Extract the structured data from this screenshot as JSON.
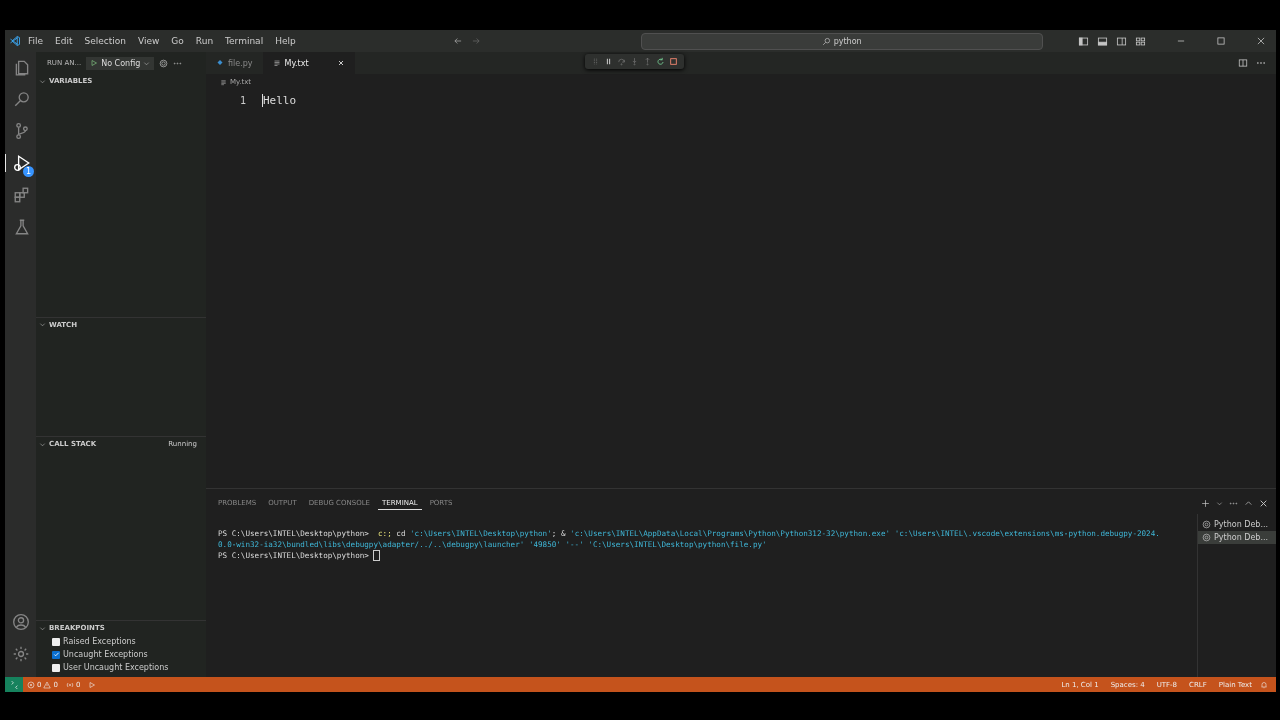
{
  "menu": [
    "File",
    "Edit",
    "Selection",
    "View",
    "Go",
    "Run",
    "Terminal",
    "Help"
  ],
  "command_center": {
    "value": "python"
  },
  "activity_bar": [
    {
      "kind": "files",
      "selected": false
    },
    {
      "kind": "search",
      "selected": false
    },
    {
      "kind": "branch",
      "selected": false
    },
    {
      "kind": "debug",
      "selected": true,
      "badge": "1"
    },
    {
      "kind": "extensions",
      "selected": false
    },
    {
      "kind": "flask",
      "selected": false
    }
  ],
  "sidebar": {
    "title": "RUN AN...",
    "config": "No Config",
    "sections": [
      {
        "title": "VARIABLES"
      },
      {
        "title": "WATCH"
      },
      {
        "title": "CALL STACK",
        "status": "Running"
      }
    ],
    "breakpoints": {
      "title": "BREAKPOINTS",
      "items": [
        {
          "label": "Raised Exceptions",
          "checked": false
        },
        {
          "label": "Uncaught Exceptions",
          "checked": true
        },
        {
          "label": "User Uncaught Exceptions",
          "checked": false
        }
      ]
    }
  },
  "tabs": [
    {
      "label": "file.py",
      "kind": "python",
      "selected": false
    },
    {
      "label": "My.txt",
      "kind": "text",
      "selected": true
    }
  ],
  "breadcrumb": "My.txt",
  "editor": {
    "lines": [
      {
        "number": "1",
        "text": "Hello"
      }
    ]
  },
  "panel": {
    "tabs": [
      {
        "label": "PROBLEMS",
        "selected": false
      },
      {
        "label": "OUTPUT",
        "selected": false
      },
      {
        "label": "DEBUG CONSOLE",
        "selected": false
      },
      {
        "label": "TERMINAL",
        "selected": true
      },
      {
        "label": "PORTS",
        "selected": false
      }
    ],
    "terminal": [
      [
        {
          "kind": "prompt",
          "text": "PS C:\\Users\\INTEL\\Desktop\\python>  "
        },
        {
          "kind": "command",
          "text": "c:; "
        },
        {
          "kind": "plain",
          "text": "cd "
        },
        {
          "kind": "string",
          "text": "'c:\\Users\\INTEL\\Desktop\\python'"
        },
        {
          "kind": "plain",
          "text": "; & "
        },
        {
          "kind": "string",
          "text": "'c:\\Users\\INTEL\\AppData\\Local\\Programs\\Python\\Python312-32\\python.exe' 'c:\\Users\\INTEL\\.vscode\\extensions\\ms-python.debugpy-2024."
        }
      ],
      [
        {
          "kind": "string",
          "text": "0.0-win32-ia32\\bundled\\libs\\debugpy\\adapter/../..\\debugpy\\launcher' '49850' '--' 'C:\\Users\\INTEL\\Desktop\\python\\file.py'"
        }
      ],
      [
        {
          "kind": "prompt",
          "text": "PS C:\\Users\\INTEL\\Desktop\\python> "
        }
      ]
    ],
    "sessions": [
      {
        "label": "Python Deb...",
        "selected": false
      },
      {
        "label": "Python Deb...",
        "selected": true
      }
    ]
  },
  "status_bar": {
    "errors": "0",
    "warnings": "0",
    "ports": "0",
    "right": [
      "Ln 1, Col 1",
      "Spaces: 4",
      "UTF-8",
      "CRLF",
      "Plain Text"
    ]
  }
}
